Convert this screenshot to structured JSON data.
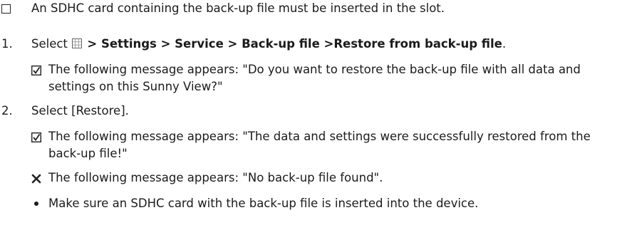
{
  "precondition": {
    "text": "An SDHC card containing the back-up file must be inserted in the slot."
  },
  "steps": [
    {
      "number": "1.",
      "prefix": "Select",
      "path": "> Settings > Service > Back-up file >Restore from back-up file",
      "suffix": ".",
      "result_line1": "The following message appears: \"Do you want to restore the back-up file with all data and",
      "result_line2": "settings on this Sunny View?\""
    },
    {
      "number": "2.",
      "label": "Select [Restore].",
      "result_line1": "The following message appears: \"The data and settings were successfully restored from the",
      "result_line2": "back-up file!\"",
      "error_text": "The following message appears: \"No back-up file found\".",
      "remedy_text": "Make sure an SDHC card with the back-up file is inserted into the device."
    }
  ]
}
